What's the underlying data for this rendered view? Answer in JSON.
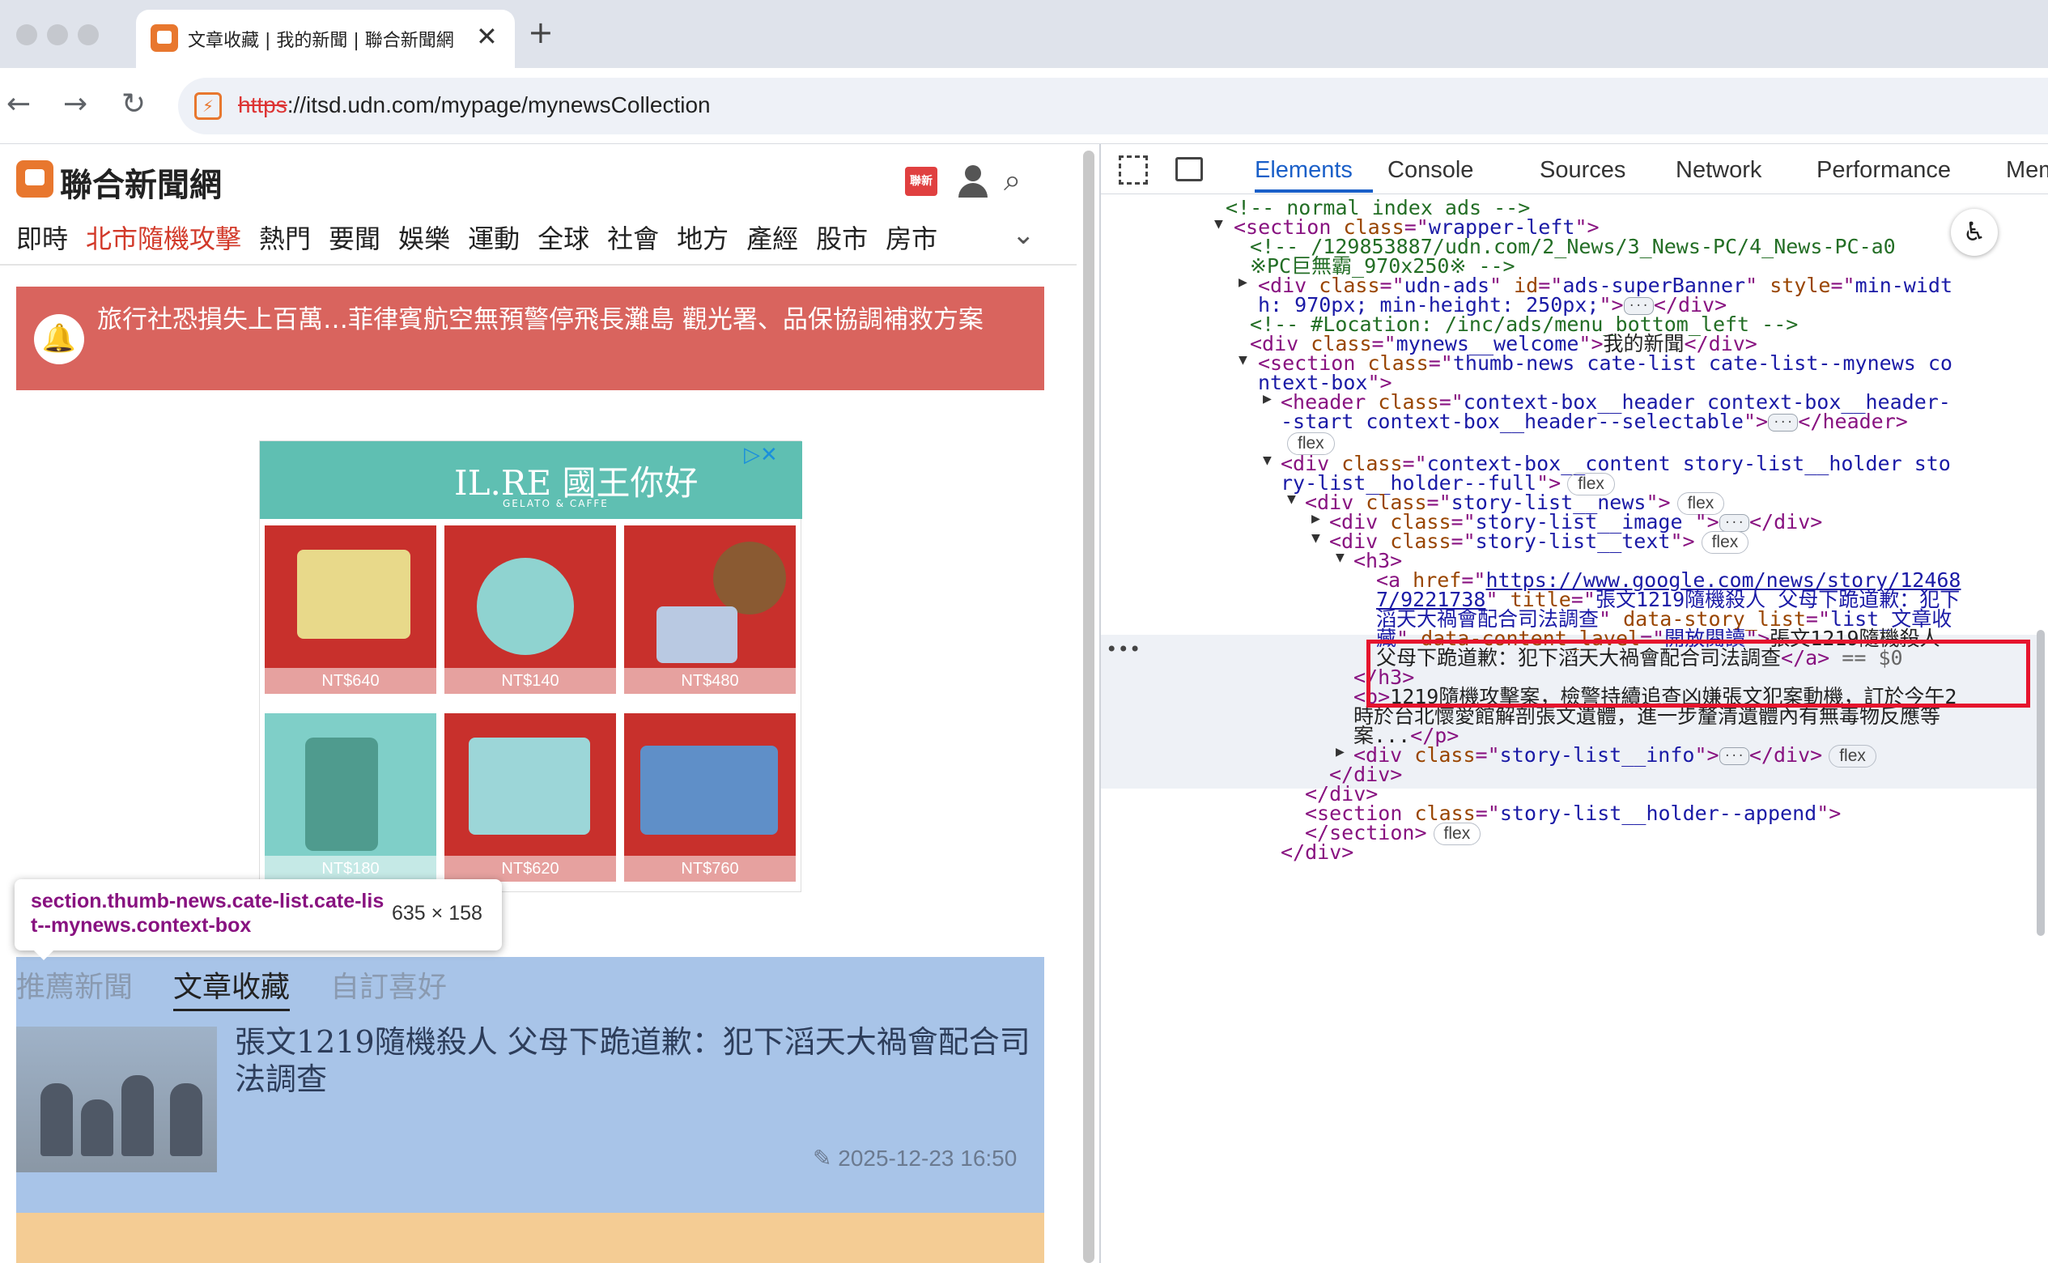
{
  "browser": {
    "tab_title": "文章收藏 | 我的新聞 | 聯合新聞網",
    "tab_close": "✕",
    "new_tab": "+",
    "url_scheme": "https",
    "url_rest": "://itsd.udn.com/mypage/mynewsCollection",
    "back": "←",
    "forward": "→",
    "reload": "↻"
  },
  "page": {
    "logo": "聯合新聞網",
    "badge": "聯新",
    "menu": [
      "即時",
      "北市隨機攻擊",
      "熱門",
      "要聞",
      "娛樂",
      "運動",
      "全球",
      "社會",
      "地方",
      "產經",
      "股市",
      "房市"
    ],
    "menu_more": "⌄",
    "alert_text": "旅行社恐損失上百萬…菲律賓航空無預警停飛長灘島 觀光署、品保協調補救方案",
    "ad": {
      "brand": "IL.RE 國王你好",
      "sub": "GELATO & CAFFE",
      "choice": "▷✕",
      "prices": [
        "NT$640",
        "NT$140",
        "NT$480",
        "NT$180",
        "NT$620",
        "NT$760"
      ]
    },
    "inspect": {
      "selector": "section.thumb-news.cate-list.cate-list--mynews.context-box",
      "size": "635 × 158"
    },
    "tabs": [
      "推薦新聞",
      "文章收藏",
      "自訂喜好"
    ],
    "story": {
      "title": "張文1219隨機殺人 父母下跪道歉：犯下滔天大禍會配合司法調查",
      "time": "2025-12-23 16:50"
    }
  },
  "devtools": {
    "tabs": [
      "Elements",
      "Console",
      "Sources",
      "Network",
      "Performance",
      "Mem"
    ],
    "active_tab": "Elements",
    "dom": {
      "l1": "<!-- normal index ads -->",
      "l2_tag": "section",
      "l2_cls": "wrapper-left",
      "l3a": "<!-- /129853887/udn.com/2_News/3_News-PC/4_News-PC-a0",
      "l3b": "※PC巨無霸_970x250※ -->",
      "l4_cls": "udn-ads",
      "l4_id": "ads-superBanner",
      "l4_style_a": "min-widt",
      "l4_style_b": "h: 970px; min-height: 250px;",
      "l5": "<!-- #Location: /inc/ads/menu_bottom_left -->",
      "l6_cls": "mynews__welcome",
      "l6_text": "我的新聞",
      "l7_cls_a": "thumb-news cate-list cate-list--mynews co",
      "l7_cls_b": "ntext-box",
      "l8_cls_a": "context-box__header context-box__header-",
      "l8_cls_b": "-start context-box__header--selectable",
      "l9_cls_a": "context-box__content story-list__holder sto",
      "l9_cls_b": "ry-list__holder--full",
      "l10_cls": "story-list__news",
      "l11_cls": "story-list__image ",
      "l12_cls": "story-list__text",
      "href_a": "https://www.google.com/news/story/12468",
      "href_b": "7/9221738",
      "title_a": "張文1219隨機殺人 父母下跪道歉：犯下",
      "title_b": "滔天大禍會配合司法調查",
      "ds_a": "list_文章收",
      "ds_b": "藏",
      "dcl": "開放閱讀",
      "a_text_a": "張文1219隨機殺人",
      "a_text_b": "父母下跪道歉：犯下滔天大禍會配合司法調查",
      "eq": "== $0",
      "p_a": "1219隨機攻擊案，檢警持續追查凶嫌張文犯案動機，訂於今午2",
      "p_b": "時於台北懷愛館解剖張文遺體，進一步釐清遺體內有無毒物反應等",
      "p_c": "案...",
      "info_cls": "story-list__info",
      "append_cls": "story-list__holder--append",
      "flex": "flex",
      "more": "•••"
    }
  },
  "colors": {
    "brand_orange": "#e8772e",
    "alert_red": "#d9645e",
    "highlight_blue": "#a8c4e8",
    "devtools_blue": "#1a5fc8",
    "select_red": "#e6142d"
  }
}
